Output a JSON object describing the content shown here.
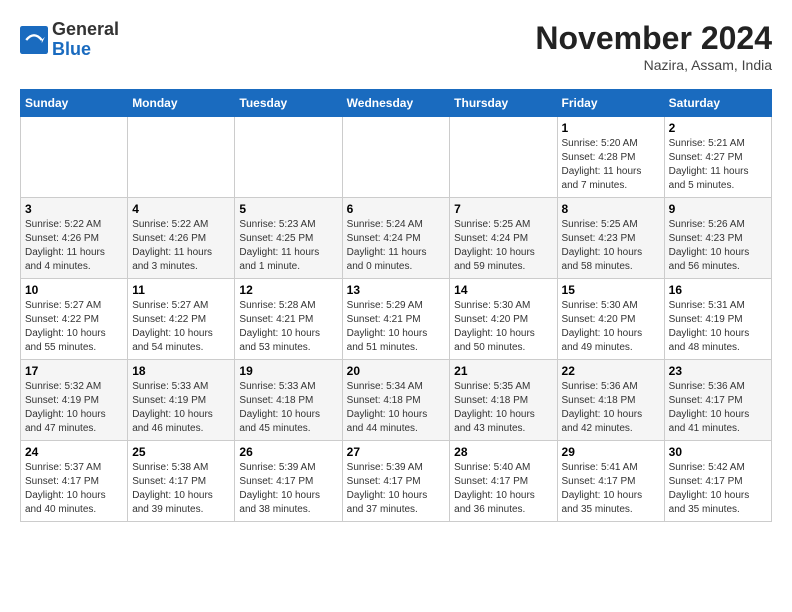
{
  "header": {
    "logo_general": "General",
    "logo_blue": "Blue",
    "title": "November 2024",
    "subtitle": "Nazira, Assam, India"
  },
  "calendar": {
    "days_of_week": [
      "Sunday",
      "Monday",
      "Tuesday",
      "Wednesday",
      "Thursday",
      "Friday",
      "Saturday"
    ],
    "weeks": [
      [
        {
          "day": "",
          "info": ""
        },
        {
          "day": "",
          "info": ""
        },
        {
          "day": "",
          "info": ""
        },
        {
          "day": "",
          "info": ""
        },
        {
          "day": "",
          "info": ""
        },
        {
          "day": "1",
          "info": "Sunrise: 5:20 AM\nSunset: 4:28 PM\nDaylight: 11 hours\nand 7 minutes."
        },
        {
          "day": "2",
          "info": "Sunrise: 5:21 AM\nSunset: 4:27 PM\nDaylight: 11 hours\nand 5 minutes."
        }
      ],
      [
        {
          "day": "3",
          "info": "Sunrise: 5:22 AM\nSunset: 4:26 PM\nDaylight: 11 hours\nand 4 minutes."
        },
        {
          "day": "4",
          "info": "Sunrise: 5:22 AM\nSunset: 4:26 PM\nDaylight: 11 hours\nand 3 minutes."
        },
        {
          "day": "5",
          "info": "Sunrise: 5:23 AM\nSunset: 4:25 PM\nDaylight: 11 hours\nand 1 minute."
        },
        {
          "day": "6",
          "info": "Sunrise: 5:24 AM\nSunset: 4:24 PM\nDaylight: 11 hours\nand 0 minutes."
        },
        {
          "day": "7",
          "info": "Sunrise: 5:25 AM\nSunset: 4:24 PM\nDaylight: 10 hours\nand 59 minutes."
        },
        {
          "day": "8",
          "info": "Sunrise: 5:25 AM\nSunset: 4:23 PM\nDaylight: 10 hours\nand 58 minutes."
        },
        {
          "day": "9",
          "info": "Sunrise: 5:26 AM\nSunset: 4:23 PM\nDaylight: 10 hours\nand 56 minutes."
        }
      ],
      [
        {
          "day": "10",
          "info": "Sunrise: 5:27 AM\nSunset: 4:22 PM\nDaylight: 10 hours\nand 55 minutes."
        },
        {
          "day": "11",
          "info": "Sunrise: 5:27 AM\nSunset: 4:22 PM\nDaylight: 10 hours\nand 54 minutes."
        },
        {
          "day": "12",
          "info": "Sunrise: 5:28 AM\nSunset: 4:21 PM\nDaylight: 10 hours\nand 53 minutes."
        },
        {
          "day": "13",
          "info": "Sunrise: 5:29 AM\nSunset: 4:21 PM\nDaylight: 10 hours\nand 51 minutes."
        },
        {
          "day": "14",
          "info": "Sunrise: 5:30 AM\nSunset: 4:20 PM\nDaylight: 10 hours\nand 50 minutes."
        },
        {
          "day": "15",
          "info": "Sunrise: 5:30 AM\nSunset: 4:20 PM\nDaylight: 10 hours\nand 49 minutes."
        },
        {
          "day": "16",
          "info": "Sunrise: 5:31 AM\nSunset: 4:19 PM\nDaylight: 10 hours\nand 48 minutes."
        }
      ],
      [
        {
          "day": "17",
          "info": "Sunrise: 5:32 AM\nSunset: 4:19 PM\nDaylight: 10 hours\nand 47 minutes."
        },
        {
          "day": "18",
          "info": "Sunrise: 5:33 AM\nSunset: 4:19 PM\nDaylight: 10 hours\nand 46 minutes."
        },
        {
          "day": "19",
          "info": "Sunrise: 5:33 AM\nSunset: 4:18 PM\nDaylight: 10 hours\nand 45 minutes."
        },
        {
          "day": "20",
          "info": "Sunrise: 5:34 AM\nSunset: 4:18 PM\nDaylight: 10 hours\nand 44 minutes."
        },
        {
          "day": "21",
          "info": "Sunrise: 5:35 AM\nSunset: 4:18 PM\nDaylight: 10 hours\nand 43 minutes."
        },
        {
          "day": "22",
          "info": "Sunrise: 5:36 AM\nSunset: 4:18 PM\nDaylight: 10 hours\nand 42 minutes."
        },
        {
          "day": "23",
          "info": "Sunrise: 5:36 AM\nSunset: 4:17 PM\nDaylight: 10 hours\nand 41 minutes."
        }
      ],
      [
        {
          "day": "24",
          "info": "Sunrise: 5:37 AM\nSunset: 4:17 PM\nDaylight: 10 hours\nand 40 minutes."
        },
        {
          "day": "25",
          "info": "Sunrise: 5:38 AM\nSunset: 4:17 PM\nDaylight: 10 hours\nand 39 minutes."
        },
        {
          "day": "26",
          "info": "Sunrise: 5:39 AM\nSunset: 4:17 PM\nDaylight: 10 hours\nand 38 minutes."
        },
        {
          "day": "27",
          "info": "Sunrise: 5:39 AM\nSunset: 4:17 PM\nDaylight: 10 hours\nand 37 minutes."
        },
        {
          "day": "28",
          "info": "Sunrise: 5:40 AM\nSunset: 4:17 PM\nDaylight: 10 hours\nand 36 minutes."
        },
        {
          "day": "29",
          "info": "Sunrise: 5:41 AM\nSunset: 4:17 PM\nDaylight: 10 hours\nand 35 minutes."
        },
        {
          "day": "30",
          "info": "Sunrise: 5:42 AM\nSunset: 4:17 PM\nDaylight: 10 hours\nand 35 minutes."
        }
      ]
    ]
  }
}
